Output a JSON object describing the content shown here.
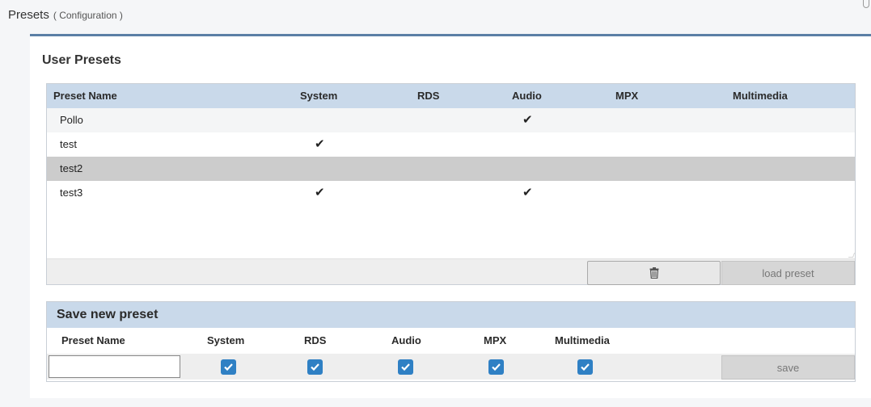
{
  "header": {
    "title": "Presets",
    "subtitle": "( Configuration )"
  },
  "user_presets": {
    "title": "User Presets",
    "columns": [
      "Preset Name",
      "System",
      "RDS",
      "Audio",
      "MPX",
      "Multimedia"
    ],
    "rows": [
      {
        "name": "Pollo",
        "system": false,
        "rds": false,
        "audio": true,
        "mpx": false,
        "multimedia": false
      },
      {
        "name": "test",
        "system": true,
        "rds": false,
        "audio": false,
        "mpx": false,
        "multimedia": false
      },
      {
        "name": "test2",
        "system": false,
        "rds": false,
        "audio": false,
        "mpx": false,
        "multimedia": false,
        "selected": true
      },
      {
        "name": "test3",
        "system": true,
        "rds": false,
        "audio": true,
        "mpx": false,
        "multimedia": false
      }
    ],
    "check_glyph": "✔",
    "delete_icon": "trash-icon",
    "load_label": "load preset"
  },
  "save_new": {
    "title": "Save new preset",
    "columns": [
      "Preset Name",
      "System",
      "RDS",
      "Audio",
      "MPX",
      "Multimedia"
    ],
    "name_value": "",
    "checked": {
      "system": true,
      "rds": true,
      "audio": true,
      "mpx": true,
      "multimedia": true
    },
    "save_label": "save"
  },
  "colors": {
    "accent_border": "#5b7fa6",
    "table_header": "#c9d9ea",
    "selected_row": "#cccccc",
    "checkbox": "#2f80c4"
  }
}
